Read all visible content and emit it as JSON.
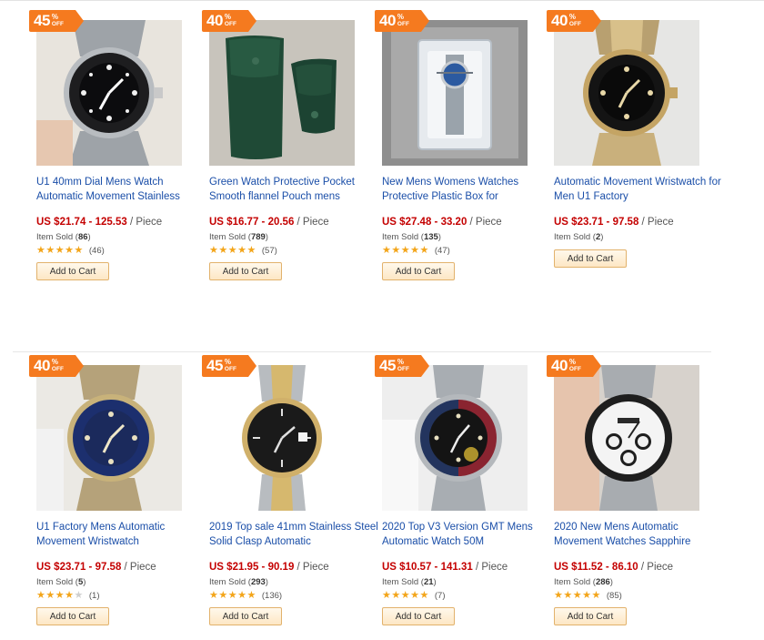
{
  "products": [
    {
      "discount_num": "45",
      "discount_pct": "%",
      "discount_off": "OFF",
      "title": "U1 40mm Dial Mens Watch Automatic Movement Stainless",
      "price": "US $21.74 - 125.53",
      "unit": "/ Piece",
      "sold_label": "Item Sold (",
      "sold": "86",
      "sold_close": ")",
      "rating": 5,
      "reviews": "(46)",
      "cart": "Add to Cart"
    },
    {
      "discount_num": "40",
      "discount_pct": "%",
      "discount_off": "OFF",
      "title": "Green Watch Protective Pocket Smooth flannel Pouch mens",
      "price": "US $16.77 - 20.56",
      "unit": "/ Piece",
      "sold_label": "Item Sold (",
      "sold": "789",
      "sold_close": ")",
      "rating": 5,
      "reviews": "(57)",
      "cart": "Add to Cart"
    },
    {
      "discount_num": "40",
      "discount_pct": "%",
      "discount_off": "OFF",
      "title": "New Mens Womens Watches Protective Plastic Box for",
      "price": "US $27.48 - 33.20",
      "unit": "/ Piece",
      "sold_label": "Item Sold (",
      "sold": "135",
      "sold_close": ")",
      "rating": 5,
      "reviews": "(47)",
      "cart": "Add to Cart"
    },
    {
      "discount_num": "40",
      "discount_pct": "%",
      "discount_off": "OFF",
      "title": "Automatic Movement Wristwatch for Men U1 Factory",
      "price": "US $23.71 - 97.58",
      "unit": "/ Piece",
      "sold_label": "Item Sold (",
      "sold": "2",
      "sold_close": ")",
      "rating": 0,
      "reviews": "",
      "cart": "Add to Cart"
    },
    {
      "discount_num": "40",
      "discount_pct": "%",
      "discount_off": "OFF",
      "title": "U1 Factory Mens Automatic Movement Wristwatch",
      "price": "US $23.71 - 97.58",
      "unit": "/ Piece",
      "sold_label": "Item Sold (",
      "sold": "5",
      "sold_close": ")",
      "rating": 4,
      "reviews": "(1)",
      "cart": "Add to Cart"
    },
    {
      "discount_num": "45",
      "discount_pct": "%",
      "discount_off": "OFF",
      "title": "2019 Top sale 41mm Stainless Steel Solid Clasp Automatic",
      "price": "US $21.95 - 90.19",
      "unit": "/ Piece",
      "sold_label": "Item Sold (",
      "sold": "293",
      "sold_close": ")",
      "rating": 5,
      "reviews": "(136)",
      "cart": "Add to Cart"
    },
    {
      "discount_num": "45",
      "discount_pct": "%",
      "discount_off": "OFF",
      "title": "2020 Top V3 Version GMT Mens Automatic Watch 50M",
      "price": "US $10.57 - 141.31",
      "unit": "/ Piece",
      "sold_label": "Item Sold (",
      "sold": "21",
      "sold_close": ")",
      "rating": 4.5,
      "reviews": "(7)",
      "cart": "Add to Cart"
    },
    {
      "discount_num": "40",
      "discount_pct": "%",
      "discount_off": "OFF",
      "title": "2020 New Mens Automatic Movement Watches Sapphire",
      "price": "US $11.52 - 86.10",
      "unit": "/ Piece",
      "sold_label": "Item Sold (",
      "sold": "286",
      "sold_close": ")",
      "rating": 5,
      "reviews": "(85)",
      "cart": "Add to Cart"
    }
  ],
  "colors": {
    "badge": "#f57a1f",
    "title": "#1a4ea8",
    "price": "#c40000",
    "star": "#f3a51a"
  }
}
